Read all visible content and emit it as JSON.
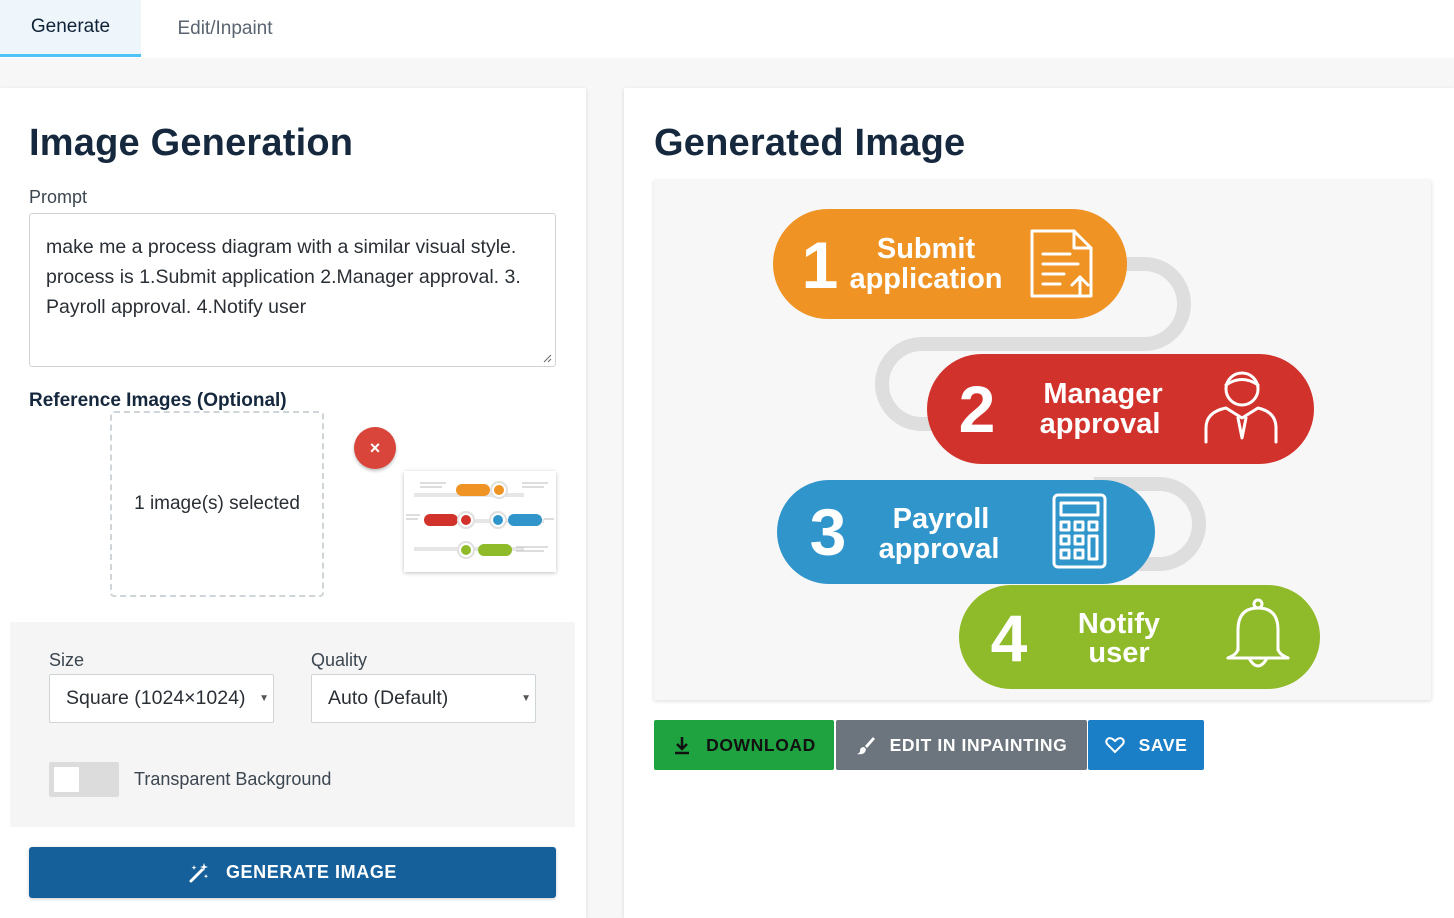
{
  "tabs": [
    {
      "label": "Generate",
      "active": true
    },
    {
      "label": "Edit/Inpaint",
      "active": false
    }
  ],
  "left": {
    "title": "Image Generation",
    "prompt_label": "Prompt",
    "prompt_value": "make me a process diagram with a similar visual style. process is 1.Submit application 2.Manager approval. 3. Payroll approval. 4.Notify user",
    "reference_label": "Reference Images (Optional)",
    "dropzone_text": "1 image(s) selected",
    "remove_symbol": "×",
    "size_label": "Size",
    "size_value": "Square (1024×1024)",
    "quality_label": "Quality",
    "quality_value": "Auto (Default)",
    "transparent_label": "Transparent Background",
    "transparent_on": false,
    "generate_button": "GENERATE IMAGE"
  },
  "right": {
    "title": "Generated Image",
    "diagram": {
      "steps": [
        {
          "number": "1",
          "line1": "Submit",
          "line2": "application",
          "color": "#ef9324",
          "icon": "document-upload-icon"
        },
        {
          "number": "2",
          "line1": "Manager",
          "line2": "approval",
          "color": "#d2322c",
          "icon": "manager-icon"
        },
        {
          "number": "3",
          "line1": "Payroll",
          "line2": "approval",
          "color": "#2f95cb",
          "icon": "calculator-icon"
        },
        {
          "number": "4",
          "line1": "Notify",
          "line2": "user",
          "color": "#8fba2a",
          "icon": "bell-icon"
        }
      ]
    },
    "buttons": {
      "download": "DOWNLOAD",
      "edit": "EDIT IN INPAINTING",
      "save": "SAVE"
    }
  },
  "colors": {
    "primary": "#15609a",
    "download": "#1fa240",
    "edit": "#6c757d",
    "save": "#1a7fc6",
    "remove": "#d9453a",
    "tab_underline": "#4fc3f7"
  }
}
